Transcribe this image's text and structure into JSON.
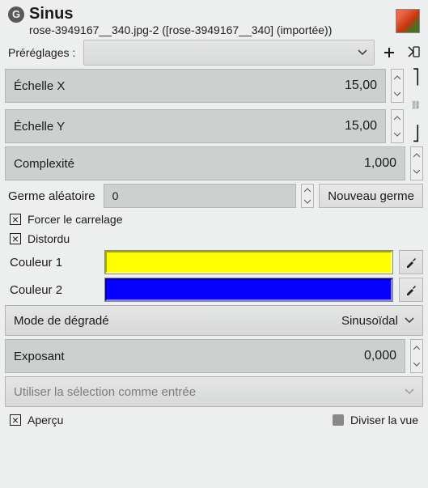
{
  "header": {
    "title": "Sinus",
    "subtitle": "rose-3949167__340.jpg-2 ([rose-3949167__340] (importée))"
  },
  "presets": {
    "label": "Préréglages :"
  },
  "sliders": {
    "scale_x": {
      "label": "Échelle X",
      "value": "15,00"
    },
    "scale_y": {
      "label": "Échelle Y",
      "value": "15,00"
    },
    "complexity": {
      "label": "Complexité",
      "value": "1,000"
    },
    "exposant": {
      "label": "Exposant",
      "value": "0,000"
    }
  },
  "random": {
    "label": "Germe aléatoire",
    "value": "0",
    "new_button": "Nouveau germe"
  },
  "checks": {
    "tiling": "Forcer le carrelage",
    "distorted": "Distordu"
  },
  "colors": {
    "c1": {
      "label": "Couleur 1",
      "hex": "#ffff00"
    },
    "c2": {
      "label": "Couleur 2",
      "hex": "#0800ff"
    }
  },
  "blend_mode": {
    "label": "Mode de dégradé",
    "value": "Sinusoïdal"
  },
  "selection_as_input": {
    "label": "Utiliser la sélection comme entrée"
  },
  "footer": {
    "preview": "Aperçu",
    "split": "Diviser la vue"
  }
}
